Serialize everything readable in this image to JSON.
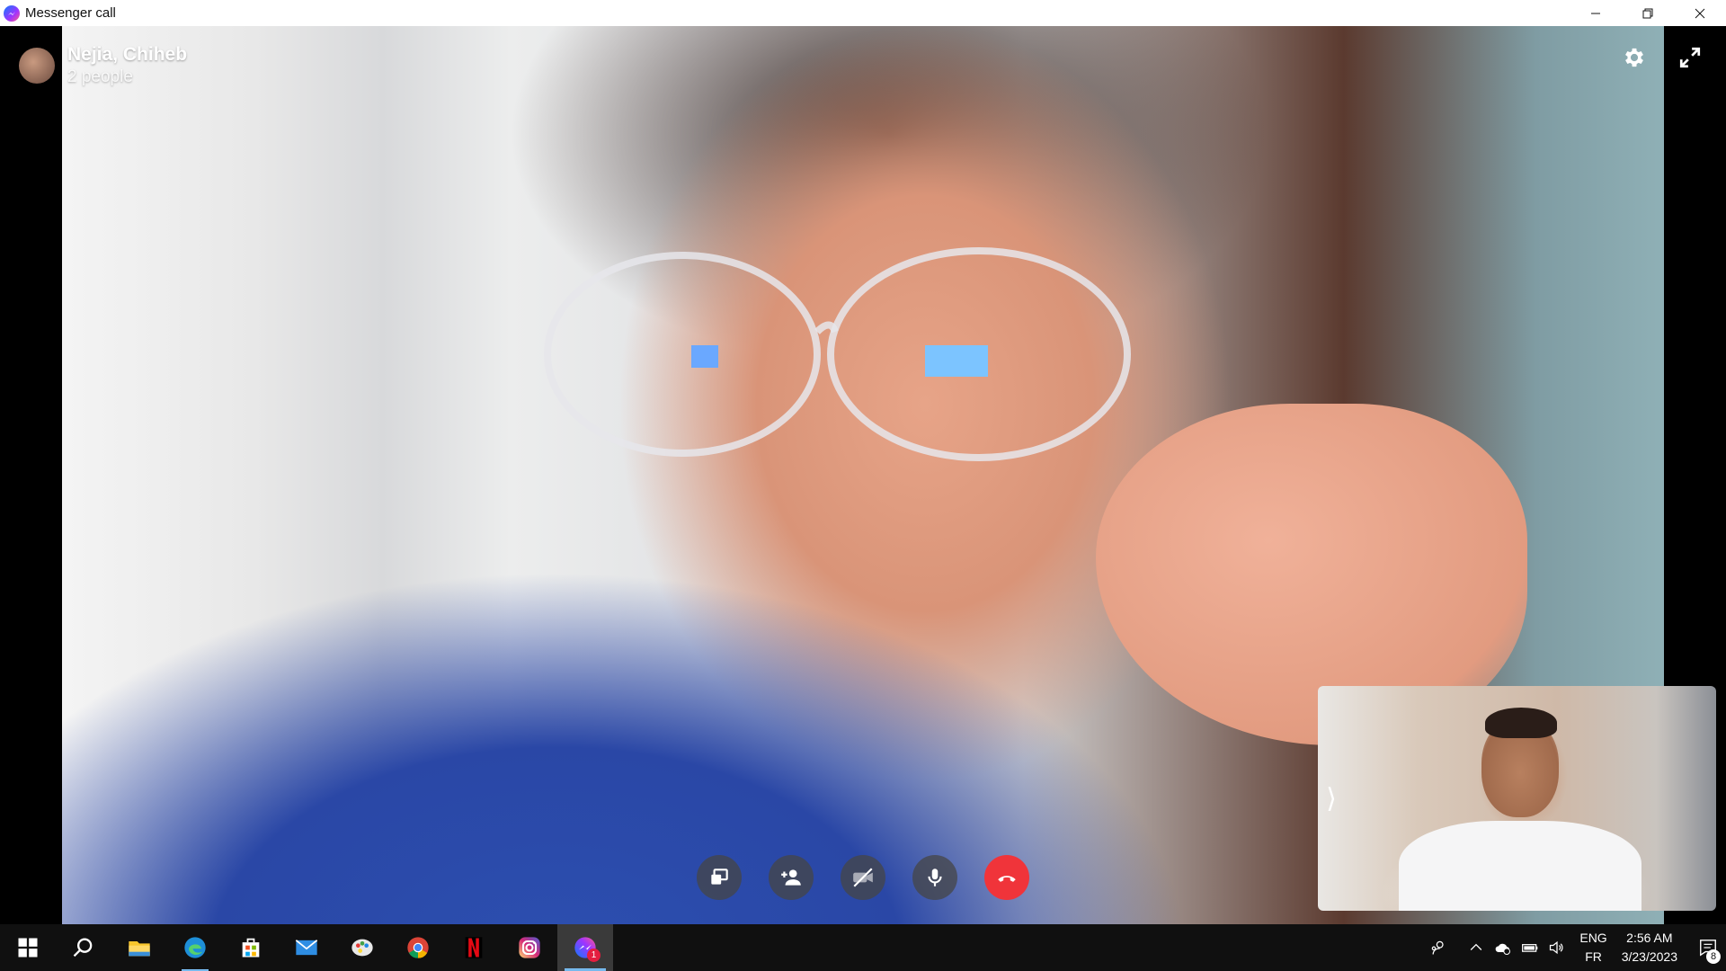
{
  "window": {
    "title": "Messenger call",
    "controls": [
      "minimize",
      "restore",
      "close"
    ]
  },
  "call": {
    "title": "Nejia, Chiheb",
    "subtitle": "2 people",
    "top_actions": [
      {
        "name": "settings",
        "icon": "gear-icon"
      },
      {
        "name": "fullscreen",
        "icon": "expand-icon"
      }
    ],
    "controls": [
      {
        "name": "share-screen",
        "icon": "share-screen-icon"
      },
      {
        "name": "add-people",
        "icon": "add-person-icon"
      },
      {
        "name": "camera-off",
        "icon": "video-off-icon"
      },
      {
        "name": "microphone",
        "icon": "microphone-icon"
      },
      {
        "name": "end-call",
        "icon": "hang-up-icon",
        "color": "#f0343a"
      }
    ],
    "self_view_collapse_glyph": "⟩"
  },
  "taskbar": {
    "apps": [
      {
        "name": "start",
        "icon": "windows-icon"
      },
      {
        "name": "search",
        "icon": "search-icon"
      },
      {
        "name": "file-explorer",
        "icon": "folder-icon"
      },
      {
        "name": "edge",
        "icon": "edge-icon"
      },
      {
        "name": "microsoft-store",
        "icon": "store-icon"
      },
      {
        "name": "mail",
        "icon": "mail-icon"
      },
      {
        "name": "paint",
        "icon": "paint-icon"
      },
      {
        "name": "chrome",
        "icon": "chrome-icon"
      },
      {
        "name": "netflix",
        "icon": "netflix-icon"
      },
      {
        "name": "instagram",
        "icon": "instagram-icon"
      },
      {
        "name": "messenger",
        "icon": "messenger-icon",
        "badge": "1"
      }
    ],
    "tray": {
      "lang_top": "ENG",
      "lang_bottom": "FR",
      "time": "2:56 AM",
      "date": "3/23/2023",
      "notification_count": "8"
    }
  },
  "colors": {
    "accent": "#76b9ed",
    "hangup": "#f0343a",
    "taskbar": "#101010"
  }
}
